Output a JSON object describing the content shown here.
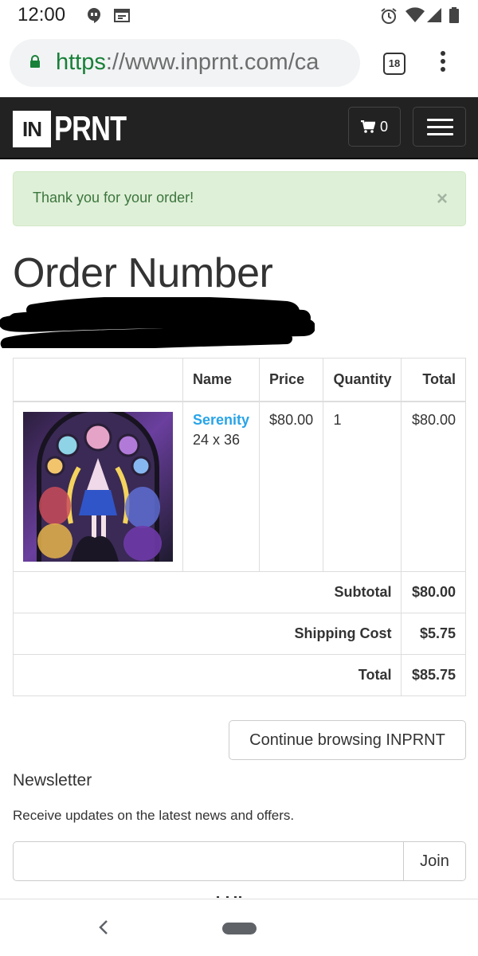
{
  "status_bar": {
    "time": "12:00"
  },
  "browser": {
    "url_scheme": "https",
    "url_separator": "://",
    "url_rest": "www.inprnt.com/ca",
    "tab_count": "18"
  },
  "site": {
    "logo_in": "IN",
    "logo_prnt": "PRNT",
    "cart_count": "0"
  },
  "alert": {
    "message": "Thank you for your order!",
    "close": "×"
  },
  "page_title": "Order Number",
  "order_table": {
    "headers": [
      "",
      "Name",
      "Price",
      "Quantity",
      "Total"
    ],
    "item": {
      "name": "Serenity",
      "size": "24 x 36",
      "price": "$80.00",
      "quantity": "1",
      "total": "$80.00"
    },
    "summary": [
      {
        "label": "Subtotal",
        "value": "$80.00"
      },
      {
        "label": "Shipping Cost",
        "value": "$5.75"
      },
      {
        "label": "Total",
        "value": "$85.75"
      }
    ]
  },
  "continue_label": "Continue browsing INPRNT",
  "newsletter": {
    "title": "Newsletter",
    "description": "Receive updates on the latest news and offers.",
    "input_value": "",
    "join_label": "Join"
  }
}
